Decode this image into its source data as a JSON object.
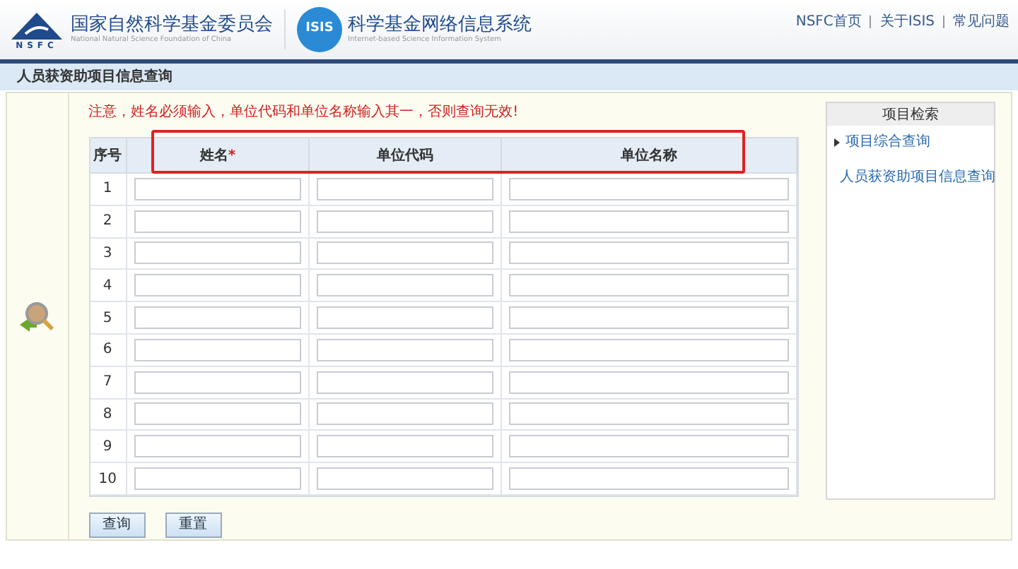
{
  "header": {
    "nsfc_logo_text": "NSFC",
    "org_name": "国家自然科学基金委员会",
    "org_name_en": "National Natural Science Foundation of China",
    "isis_logo_text": "ISIS",
    "system_name": "科学基金网络信息系统",
    "system_name_en": "Internet-based Science Information System",
    "links": [
      "NSFC首页",
      "关于ISIS",
      "常见问题"
    ]
  },
  "page_title": "人员获资助项目信息查询",
  "notice": "注意，姓名必须输入，单位代码和单位名称输入其一，否则查询无效!",
  "table": {
    "columns": [
      {
        "label": "序号",
        "required": false
      },
      {
        "label": "姓名",
        "required": true
      },
      {
        "label": "单位代码",
        "required": false
      },
      {
        "label": "单位名称",
        "required": false
      }
    ],
    "required_mark": "*",
    "rows": [
      "1",
      "2",
      "3",
      "4",
      "5",
      "6",
      "7",
      "8",
      "9",
      "10"
    ]
  },
  "buttons": [
    "查询",
    "重置"
  ],
  "side_panel": {
    "title": "项目检索",
    "items": [
      "项目综合查询",
      "人员获资助项目信息查询"
    ]
  }
}
